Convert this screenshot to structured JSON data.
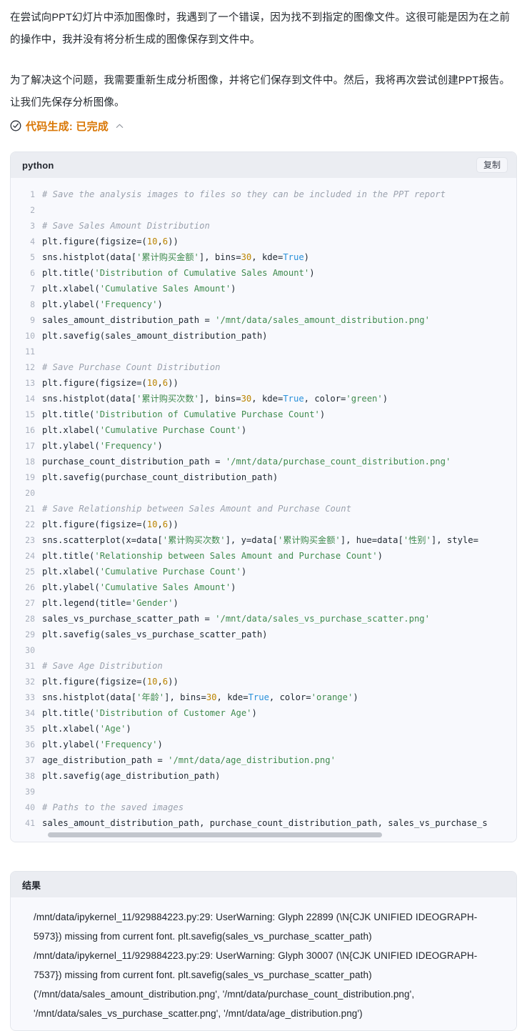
{
  "intro": {
    "paragraph_1": "在尝试向PPT幻灯片中添加图像时，我遇到了一个错误，因为找不到指定的图像文件。这很可能是因为在之前的操作中，我并没有将分析生成的图像保存到文件中。",
    "paragraph_2": "为了解决这个问题，我需要重新生成分析图像，并将它们保存到文件中。然后，我将再次尝试创建PPT报告。让我们先保存分析图像。"
  },
  "status": {
    "label": "代码生成: 已完成",
    "icon": "circle-check-icon",
    "chevron": "chevron-up-icon",
    "accent_color": "#d97706"
  },
  "code_block": {
    "language": "python",
    "copy_label": "复制",
    "lines": [
      {
        "n": "1",
        "tokens": [
          {
            "t": "# Save the analysis images to files so they can be included in the PPT report",
            "c": "com"
          }
        ]
      },
      {
        "n": "2",
        "tokens": []
      },
      {
        "n": "3",
        "tokens": [
          {
            "t": "# Save Sales Amount Distribution",
            "c": "com"
          }
        ]
      },
      {
        "n": "4",
        "tokens": [
          {
            "t": "plt.figure(figsize=(",
            "c": "pln"
          },
          {
            "t": "10",
            "c": "num"
          },
          {
            "t": ",",
            "c": "pln"
          },
          {
            "t": "6",
            "c": "num"
          },
          {
            "t": "))",
            "c": "pln"
          }
        ]
      },
      {
        "n": "5",
        "tokens": [
          {
            "t": "sns.histplot(data[",
            "c": "pln"
          },
          {
            "t": "'累计购买金额'",
            "c": "str"
          },
          {
            "t": "], bins=",
            "c": "pln"
          },
          {
            "t": "30",
            "c": "num"
          },
          {
            "t": ", kde=",
            "c": "pln"
          },
          {
            "t": "True",
            "c": "kw"
          },
          {
            "t": ")",
            "c": "pln"
          }
        ]
      },
      {
        "n": "6",
        "tokens": [
          {
            "t": "plt.title(",
            "c": "pln"
          },
          {
            "t": "'Distribution of Cumulative Sales Amount'",
            "c": "str"
          },
          {
            "t": ")",
            "c": "pln"
          }
        ]
      },
      {
        "n": "7",
        "tokens": [
          {
            "t": "plt.xlabel(",
            "c": "pln"
          },
          {
            "t": "'Cumulative Sales Amount'",
            "c": "str"
          },
          {
            "t": ")",
            "c": "pln"
          }
        ]
      },
      {
        "n": "8",
        "tokens": [
          {
            "t": "plt.ylabel(",
            "c": "pln"
          },
          {
            "t": "'Frequency'",
            "c": "str"
          },
          {
            "t": ")",
            "c": "pln"
          }
        ]
      },
      {
        "n": "9",
        "tokens": [
          {
            "t": "sales_amount_distribution_path = ",
            "c": "pln"
          },
          {
            "t": "'/mnt/data/sales_amount_distribution.png'",
            "c": "str"
          }
        ]
      },
      {
        "n": "10",
        "tokens": [
          {
            "t": "plt.savefig(sales_amount_distribution_path)",
            "c": "pln"
          }
        ]
      },
      {
        "n": "11",
        "tokens": []
      },
      {
        "n": "12",
        "tokens": [
          {
            "t": "# Save Purchase Count Distribution",
            "c": "com"
          }
        ]
      },
      {
        "n": "13",
        "tokens": [
          {
            "t": "plt.figure(figsize=(",
            "c": "pln"
          },
          {
            "t": "10",
            "c": "num"
          },
          {
            "t": ",",
            "c": "pln"
          },
          {
            "t": "6",
            "c": "num"
          },
          {
            "t": "))",
            "c": "pln"
          }
        ]
      },
      {
        "n": "14",
        "tokens": [
          {
            "t": "sns.histplot(data[",
            "c": "pln"
          },
          {
            "t": "'累计购买次数'",
            "c": "str"
          },
          {
            "t": "], bins=",
            "c": "pln"
          },
          {
            "t": "30",
            "c": "num"
          },
          {
            "t": ", kde=",
            "c": "pln"
          },
          {
            "t": "True",
            "c": "kw"
          },
          {
            "t": ", color=",
            "c": "pln"
          },
          {
            "t": "'green'",
            "c": "str"
          },
          {
            "t": ")",
            "c": "pln"
          }
        ]
      },
      {
        "n": "15",
        "tokens": [
          {
            "t": "plt.title(",
            "c": "pln"
          },
          {
            "t": "'Distribution of Cumulative Purchase Count'",
            "c": "str"
          },
          {
            "t": ")",
            "c": "pln"
          }
        ]
      },
      {
        "n": "16",
        "tokens": [
          {
            "t": "plt.xlabel(",
            "c": "pln"
          },
          {
            "t": "'Cumulative Purchase Count'",
            "c": "str"
          },
          {
            "t": ")",
            "c": "pln"
          }
        ]
      },
      {
        "n": "17",
        "tokens": [
          {
            "t": "plt.ylabel(",
            "c": "pln"
          },
          {
            "t": "'Frequency'",
            "c": "str"
          },
          {
            "t": ")",
            "c": "pln"
          }
        ]
      },
      {
        "n": "18",
        "tokens": [
          {
            "t": "purchase_count_distribution_path = ",
            "c": "pln"
          },
          {
            "t": "'/mnt/data/purchase_count_distribution.png'",
            "c": "str"
          }
        ]
      },
      {
        "n": "19",
        "tokens": [
          {
            "t": "plt.savefig(purchase_count_distribution_path)",
            "c": "pln"
          }
        ]
      },
      {
        "n": "20",
        "tokens": []
      },
      {
        "n": "21",
        "tokens": [
          {
            "t": "# Save Relationship between Sales Amount and Purchase Count",
            "c": "com"
          }
        ]
      },
      {
        "n": "22",
        "tokens": [
          {
            "t": "plt.figure(figsize=(",
            "c": "pln"
          },
          {
            "t": "10",
            "c": "num"
          },
          {
            "t": ",",
            "c": "pln"
          },
          {
            "t": "6",
            "c": "num"
          },
          {
            "t": "))",
            "c": "pln"
          }
        ]
      },
      {
        "n": "23",
        "tokens": [
          {
            "t": "sns.scatterplot(x=data[",
            "c": "pln"
          },
          {
            "t": "'累计购买次数'",
            "c": "str"
          },
          {
            "t": "], y=data[",
            "c": "pln"
          },
          {
            "t": "'累计购买金额'",
            "c": "str"
          },
          {
            "t": "], hue=data[",
            "c": "pln"
          },
          {
            "t": "'性别'",
            "c": "str"
          },
          {
            "t": "], style=",
            "c": "pln"
          }
        ]
      },
      {
        "n": "24",
        "tokens": [
          {
            "t": "plt.title(",
            "c": "pln"
          },
          {
            "t": "'Relationship between Sales Amount and Purchase Count'",
            "c": "str"
          },
          {
            "t": ")",
            "c": "pln"
          }
        ]
      },
      {
        "n": "25",
        "tokens": [
          {
            "t": "plt.xlabel(",
            "c": "pln"
          },
          {
            "t": "'Cumulative Purchase Count'",
            "c": "str"
          },
          {
            "t": ")",
            "c": "pln"
          }
        ]
      },
      {
        "n": "26",
        "tokens": [
          {
            "t": "plt.ylabel(",
            "c": "pln"
          },
          {
            "t": "'Cumulative Sales Amount'",
            "c": "str"
          },
          {
            "t": ")",
            "c": "pln"
          }
        ]
      },
      {
        "n": "27",
        "tokens": [
          {
            "t": "plt.legend(title=",
            "c": "pln"
          },
          {
            "t": "'Gender'",
            "c": "str"
          },
          {
            "t": ")",
            "c": "pln"
          }
        ]
      },
      {
        "n": "28",
        "tokens": [
          {
            "t": "sales_vs_purchase_scatter_path = ",
            "c": "pln"
          },
          {
            "t": "'/mnt/data/sales_vs_purchase_scatter.png'",
            "c": "str"
          }
        ]
      },
      {
        "n": "29",
        "tokens": [
          {
            "t": "plt.savefig(sales_vs_purchase_scatter_path)",
            "c": "pln"
          }
        ]
      },
      {
        "n": "30",
        "tokens": []
      },
      {
        "n": "31",
        "tokens": [
          {
            "t": "# Save Age Distribution",
            "c": "com"
          }
        ]
      },
      {
        "n": "32",
        "tokens": [
          {
            "t": "plt.figure(figsize=(",
            "c": "pln"
          },
          {
            "t": "10",
            "c": "num"
          },
          {
            "t": ",",
            "c": "pln"
          },
          {
            "t": "6",
            "c": "num"
          },
          {
            "t": "))",
            "c": "pln"
          }
        ]
      },
      {
        "n": "33",
        "tokens": [
          {
            "t": "sns.histplot(data[",
            "c": "pln"
          },
          {
            "t": "'年龄'",
            "c": "str"
          },
          {
            "t": "], bins=",
            "c": "pln"
          },
          {
            "t": "30",
            "c": "num"
          },
          {
            "t": ", kde=",
            "c": "pln"
          },
          {
            "t": "True",
            "c": "kw"
          },
          {
            "t": ", color=",
            "c": "pln"
          },
          {
            "t": "'orange'",
            "c": "str"
          },
          {
            "t": ")",
            "c": "pln"
          }
        ]
      },
      {
        "n": "34",
        "tokens": [
          {
            "t": "plt.title(",
            "c": "pln"
          },
          {
            "t": "'Distribution of Customer Age'",
            "c": "str"
          },
          {
            "t": ")",
            "c": "pln"
          }
        ]
      },
      {
        "n": "35",
        "tokens": [
          {
            "t": "plt.xlabel(",
            "c": "pln"
          },
          {
            "t": "'Age'",
            "c": "str"
          },
          {
            "t": ")",
            "c": "pln"
          }
        ]
      },
      {
        "n": "36",
        "tokens": [
          {
            "t": "plt.ylabel(",
            "c": "pln"
          },
          {
            "t": "'Frequency'",
            "c": "str"
          },
          {
            "t": ")",
            "c": "pln"
          }
        ]
      },
      {
        "n": "37",
        "tokens": [
          {
            "t": "age_distribution_path = ",
            "c": "pln"
          },
          {
            "t": "'/mnt/data/age_distribution.png'",
            "c": "str"
          }
        ]
      },
      {
        "n": "38",
        "tokens": [
          {
            "t": "plt.savefig(age_distribution_path)",
            "c": "pln"
          }
        ]
      },
      {
        "n": "39",
        "tokens": []
      },
      {
        "n": "40",
        "tokens": [
          {
            "t": "# Paths to the saved images",
            "c": "com"
          }
        ]
      },
      {
        "n": "41",
        "tokens": [
          {
            "t": "sales_amount_distribution_path, purchase_count_distribution_path, sales_vs_purchase_s",
            "c": "pln"
          }
        ]
      }
    ]
  },
  "result_block": {
    "title": "结果",
    "lines": [
      "/mnt/data/ipykernel_11/929884223.py:29: UserWarning: Glyph 22899 (\\N{CJK UNIFIED IDEOGRAPH-5973}) missing from current font. plt.savefig(sales_vs_purchase_scatter_path)",
      "/mnt/data/ipykernel_11/929884223.py:29: UserWarning: Glyph 30007 (\\N{CJK UNIFIED IDEOGRAPH-7537}) missing from current font. plt.savefig(sales_vs_purchase_scatter_path)",
      "('/mnt/data/sales_amount_distribution.png', '/mnt/data/purchase_count_distribution.png', '/mnt/data/sales_vs_purchase_scatter.png', '/mnt/data/age_distribution.png')"
    ]
  }
}
